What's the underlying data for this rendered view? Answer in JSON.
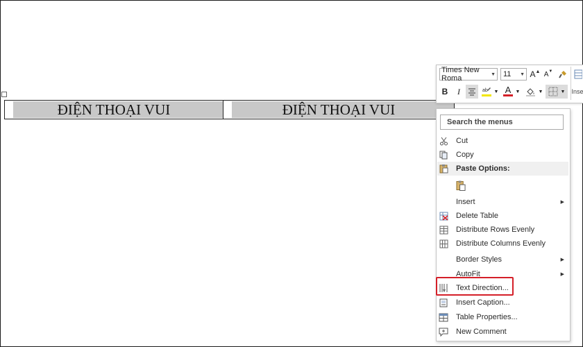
{
  "document": {
    "table": {
      "cells": [
        "ĐIỆN THOẠI VUI",
        "ĐIỆN THOẠI VUI"
      ]
    }
  },
  "mini_toolbar": {
    "font_name": "Times New Roma",
    "font_size": "11",
    "grow_font": "A",
    "shrink_font": "A",
    "bold": "B",
    "italic": "I",
    "font_color": "A",
    "truncated_insert": "Inse",
    "colors": {
      "highlight": "#f2e600",
      "font_color_bar": "#d41f28",
      "border_btn_bg": "#dcdcdc"
    }
  },
  "context_menu": {
    "search_placeholder": "Search the menus",
    "items": [
      {
        "label": "Cut",
        "icon": "scissors-icon"
      },
      {
        "label": "Copy",
        "icon": "copy-icon"
      },
      {
        "label": "Paste Options:",
        "icon": "clipboard-icon"
      },
      {
        "label": "Insert",
        "icon": "",
        "submenu": true
      },
      {
        "label": "Delete Table",
        "icon": "delete-table-icon"
      },
      {
        "label": "Distribute Rows Evenly",
        "icon": "distribute-rows-icon"
      },
      {
        "label": "Distribute Columns Evenly",
        "icon": "distribute-columns-icon"
      },
      {
        "label": "Border Styles",
        "icon": "",
        "submenu": true
      },
      {
        "label": "AutoFit",
        "icon": "",
        "submenu": true
      },
      {
        "label": "Text Direction...",
        "icon": "text-direction-icon",
        "highlighted": true
      },
      {
        "label": "Insert Caption...",
        "icon": "caption-icon"
      },
      {
        "label": "Table Properties...",
        "icon": "table-properties-icon"
      },
      {
        "label": "New Comment",
        "icon": "comment-icon"
      }
    ],
    "highlight_color": "#d41f28"
  }
}
